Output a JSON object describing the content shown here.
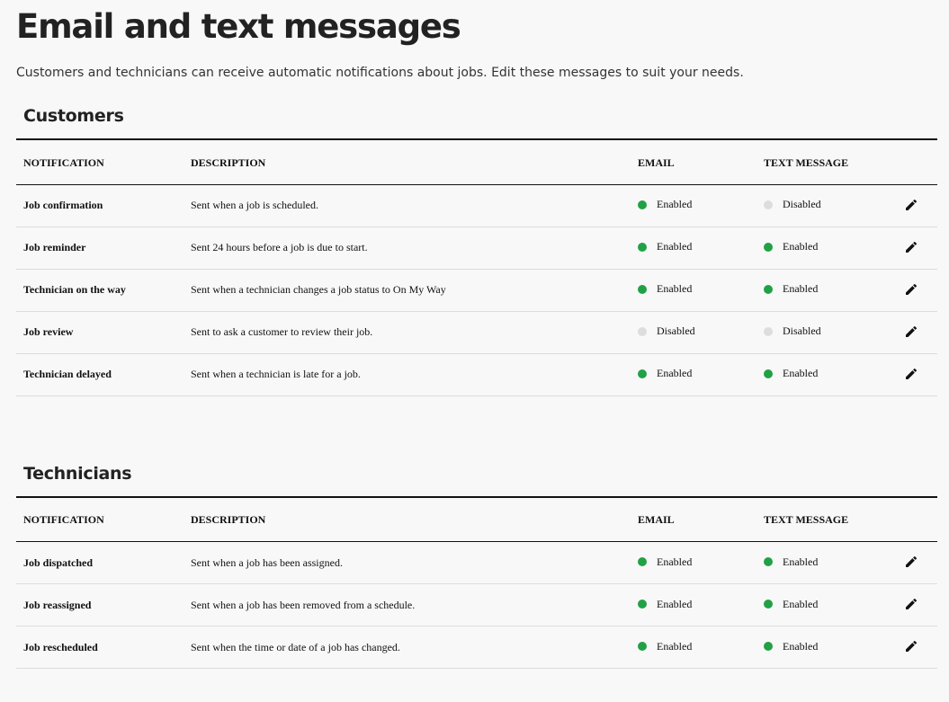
{
  "header": {
    "title": "Email and text messages",
    "subtitle": "Customers and technicians can receive automatic notifications about jobs. Edit these messages to suit your needs."
  },
  "columns": {
    "notification": "NOTIFICATION",
    "description": "DESCRIPTION",
    "email": "EMAIL",
    "text_message": "TEXT MESSAGE"
  },
  "status_labels": {
    "on": "Enabled",
    "off": "Disabled"
  },
  "colors": {
    "enabled": "#21a146",
    "disabled": "#dddddd"
  },
  "icons": {
    "edit": "pencil-icon",
    "status": "status-dot-icon"
  },
  "sections": [
    {
      "title": "Customers",
      "rows": [
        {
          "notification": "Job confirmation",
          "description": "Sent when a job is scheduled.",
          "email": "Enabled",
          "text_message": "Disabled"
        },
        {
          "notification": "Job reminder",
          "description": "Sent 24 hours before a job is due to start.",
          "email": "Enabled",
          "text_message": "Enabled"
        },
        {
          "notification": "Technician on the way",
          "description": "Sent when a technician changes a job status to On My Way",
          "email": "Enabled",
          "text_message": "Enabled"
        },
        {
          "notification": "Job review",
          "description": "Sent to ask a customer to review their job.",
          "email": "Disabled",
          "text_message": "Disabled"
        },
        {
          "notification": "Technician delayed",
          "description": "Sent when a technician is late for a job.",
          "email": "Enabled",
          "text_message": "Enabled"
        }
      ]
    },
    {
      "title": "Technicians",
      "rows": [
        {
          "notification": "Job dispatched",
          "description": "Sent when a job has been assigned.",
          "email": "Enabled",
          "text_message": "Enabled"
        },
        {
          "notification": "Job reassigned",
          "description": "Sent when a job has been removed from a schedule.",
          "email": "Enabled",
          "text_message": "Enabled"
        },
        {
          "notification": "Job rescheduled",
          "description": "Sent when the time or date of a job has changed.",
          "email": "Enabled",
          "text_message": "Enabled"
        }
      ]
    }
  ]
}
